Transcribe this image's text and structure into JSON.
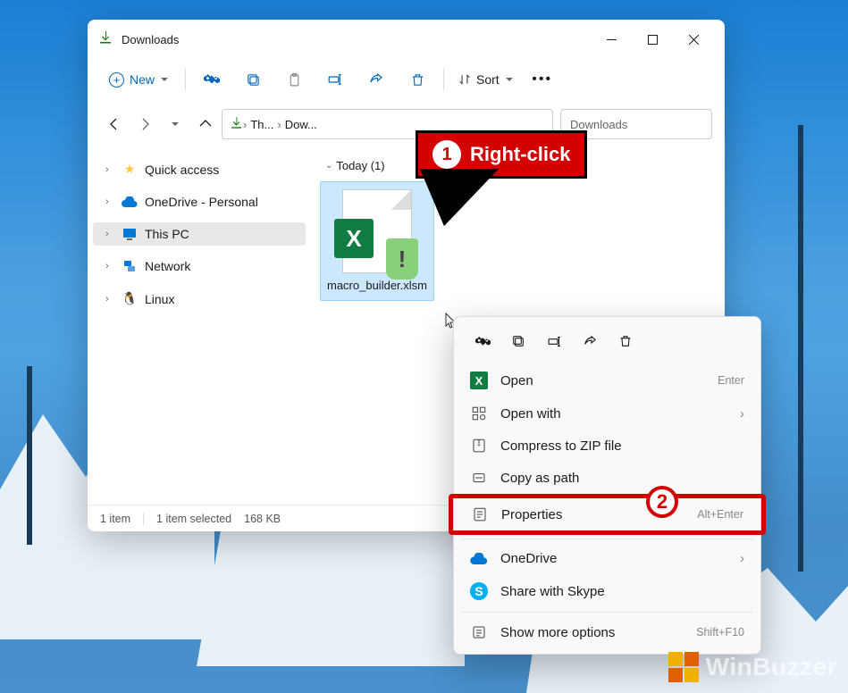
{
  "window": {
    "title": "Downloads",
    "toolbar": {
      "new_label": "New",
      "sort_label": "Sort"
    },
    "breadcrumb": {
      "seg1": "Th...",
      "seg2": "Dow..."
    },
    "search_placeholder": "Downloads"
  },
  "sidebar": {
    "items": [
      {
        "label": "Quick access"
      },
      {
        "label": "OneDrive - Personal"
      },
      {
        "label": "This PC"
      },
      {
        "label": "Network"
      },
      {
        "label": "Linux"
      }
    ]
  },
  "content": {
    "group_label": "Today (1)",
    "file_name": "macro_builder.xlsm"
  },
  "statusbar": {
    "count": "1 item",
    "selected": "1 item selected",
    "size": "168 KB"
  },
  "context_menu": {
    "open": {
      "label": "Open",
      "hint": "Enter"
    },
    "open_with": {
      "label": "Open with"
    },
    "compress": {
      "label": "Compress to ZIP file"
    },
    "copy_path": {
      "label": "Copy as path"
    },
    "properties": {
      "label": "Properties",
      "hint": "Alt+Enter"
    },
    "onedrive": {
      "label": "OneDrive"
    },
    "skype": {
      "label": "Share with Skype"
    },
    "more": {
      "label": "Show more options",
      "hint": "Shift+F10"
    }
  },
  "callouts": {
    "c1_num": "1",
    "c1_text": "Right-click",
    "c2_num": "2"
  },
  "watermark": "WinBuzzer"
}
